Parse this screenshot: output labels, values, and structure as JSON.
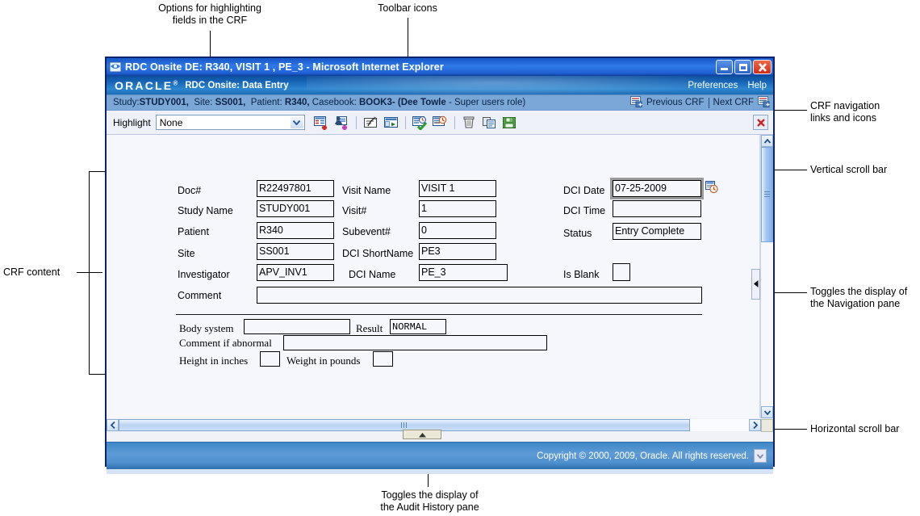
{
  "annotations": [
    {
      "id": "a1",
      "text": "Options for highlighting\nfields in the CRF"
    },
    {
      "id": "a2",
      "text": "Toolbar icons"
    },
    {
      "id": "a3",
      "text": "CRF navigation\nlinks and icons"
    },
    {
      "id": "a4",
      "text": "Vertical scroll bar"
    },
    {
      "id": "a5",
      "text": "CRF content"
    },
    {
      "id": "a6",
      "text": "Toggles the display of\nthe Navigation pane"
    },
    {
      "id": "a7",
      "text": "Horizontal scroll bar"
    },
    {
      "id": "a8",
      "text": "Toggles the display of\nthe Audit History pane"
    }
  ],
  "window": {
    "title": "RDC Onsite DE: R340, VISIT 1 , PE_3 - Microsoft Internet Explorer",
    "minimize_label": "Minimize",
    "maximize_label": "Maximize",
    "close_label": "Close"
  },
  "brand": {
    "logo": "ORACLE",
    "trademark": "®",
    "app_name": "RDC Onsite: Data Entry",
    "preferences": "Preferences",
    "help": "Help"
  },
  "context": {
    "study_label": "Study:",
    "study_value": "STUDY001,",
    "site_label": "Site:",
    "site_value": "SS001,",
    "patient_label": "Patient:",
    "patient_value": "R340,",
    "casebook_label": "Casebook:",
    "casebook_value": "BOOK3- (Dee Towle",
    "role_text": "- Super users role)",
    "previous_crf": "Previous CRF",
    "next_crf": "Next CRF"
  },
  "toolbar": {
    "highlight_label": "Highlight",
    "highlight_value": "None",
    "highlight_options": [
      "None"
    ],
    "icons": [
      "add-discrepancy-icon",
      "add-investigator-comment-icon",
      "crf-signature-icon",
      "crf-details-icon",
      "verify-crf-icon",
      "audit-history-icon",
      "delete-crf-icon",
      "copy-crf-icon",
      "save-crf-icon"
    ],
    "close_icon": "close-crf-icon"
  },
  "crf": {
    "header_fields": [
      {
        "label": "Doc#",
        "value": "R22497801"
      },
      {
        "label": "Study Name",
        "value": "STUDY001"
      },
      {
        "label": "Patient",
        "value": "R340"
      },
      {
        "label": "Site",
        "value": "SS001"
      },
      {
        "label": "Investigator",
        "value": "APV_INV1"
      }
    ],
    "mid_fields": [
      {
        "label": "Visit Name",
        "value": "VISIT 1"
      },
      {
        "label": "Visit#",
        "value": "1"
      },
      {
        "label": "Subevent#",
        "value": "0"
      },
      {
        "label": "DCI ShortName",
        "value": "PE3"
      },
      {
        "label": "DCI Name",
        "value": "PE_3"
      }
    ],
    "right_fields": [
      {
        "label": "DCI Date",
        "value": "07-25-2009"
      },
      {
        "label": "DCI Time",
        "value": ""
      },
      {
        "label": "Status",
        "value": "Entry Complete"
      }
    ],
    "is_blank_label": "Is Blank",
    "is_blank_value": "",
    "comment_label": "Comment",
    "comment_value": "",
    "calendar_icon": "calendar-picker-icon",
    "form": {
      "body_system_label": "Body system",
      "body_system_value": "",
      "result_label": "Result",
      "result_value": "NORMAL",
      "comment_abnormal_label": "Comment if abnormal",
      "comment_abnormal_value": "",
      "height_label": "Height in inches",
      "height_value": "",
      "weight_label": "Weight in pounds",
      "weight_value": ""
    }
  },
  "scrollbars": {
    "v_up": "scroll-up",
    "v_down": "scroll-down",
    "h_left": "scroll-left",
    "h_right": "scroll-right"
  },
  "nav_toggle_label": "◄",
  "audit_toggle_label": "▲",
  "footer": {
    "copyright": "Copyright © 2000, 2009, Oracle. All rights reserved."
  }
}
